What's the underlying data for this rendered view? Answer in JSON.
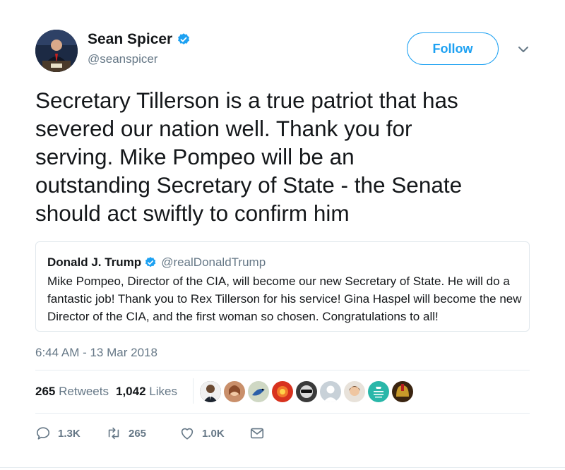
{
  "author": {
    "name": "Sean Spicer",
    "handle": "@seanspicer",
    "verified": true,
    "avatar_icon": "avatar-person-at-podium"
  },
  "follow_label": "Follow",
  "tweet_text": "Secretary Tillerson is a true patriot that has\nsevered our nation well.  Thank you for\nserving.   Mike Pompeo will be an\noutstanding Secretary of State - the Senate\nshould act swiftly to confirm him",
  "quoted_tweet": {
    "name": "Donald J. Trump",
    "handle": "@realDonaldTrump",
    "verified": true,
    "text": "Mike Pompeo, Director of the CIA, will become our new Secretary of State. He will do a fantastic job! Thank you to Rex Tillerson for his service! Gina Haspel will become the new Director of the CIA, and the first woman so chosen. Congratulations to all!"
  },
  "timestamp": "6:44 AM - 13 Mar 2018",
  "stats": {
    "retweets_count": "265",
    "retweets_label": "Retweets",
    "likes_count": "1,042",
    "likes_label": "Likes"
  },
  "liker_avatars": [
    {
      "icon": "avatar-man-suit",
      "bg": "#2b2b2b"
    },
    {
      "icon": "avatar-woman",
      "bg": "#c98f6a"
    },
    {
      "icon": "avatar-bird",
      "bg": "#6f8fb8"
    },
    {
      "icon": "avatar-red",
      "bg": "#d8321e"
    },
    {
      "icon": "avatar-dark-sunglasses",
      "bg": "#3a3a3a"
    },
    {
      "icon": "avatar-default-egg",
      "bg": "#c8d1d8"
    },
    {
      "icon": "avatar-woman-2",
      "bg": "#b58d6c"
    },
    {
      "icon": "avatar-keep-calm",
      "bg": "#2ab7a9"
    },
    {
      "icon": "avatar-gold-helmet",
      "bg": "#8c5d1a"
    }
  ],
  "actions": {
    "reply_count": "1.3K",
    "retweet_count": "265",
    "like_count": "1.0K"
  },
  "colors": {
    "accent": "#1da1f2",
    "secondary_text": "#657786",
    "verified": "#1da1f2",
    "border": "#e1e8ed"
  }
}
